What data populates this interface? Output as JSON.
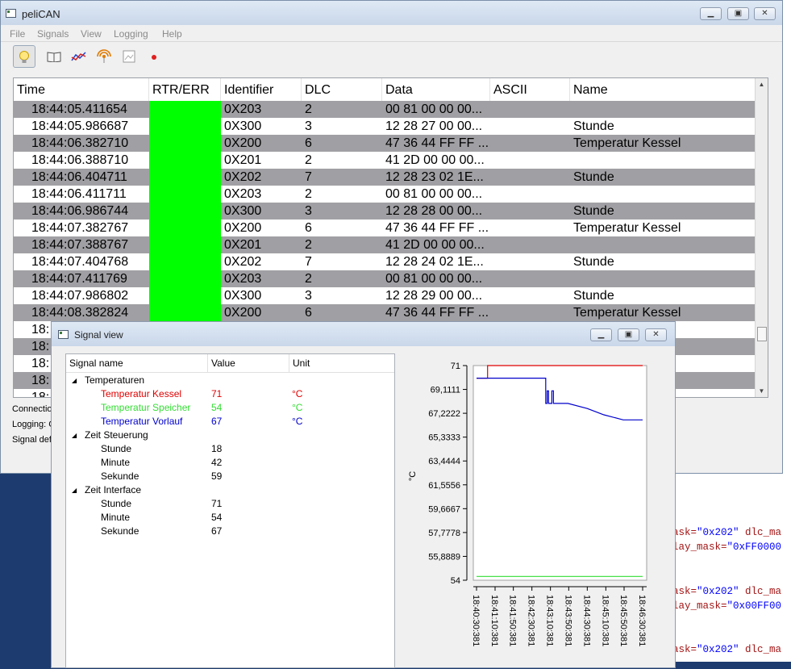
{
  "main_window": {
    "title": "peliCAN",
    "menu": [
      "File",
      "Signals",
      "View",
      "Logging",
      "Help"
    ],
    "toolbar_icons": [
      "lightbulb-icon",
      "book-icon",
      "graph-icon",
      "signal-icon",
      "image-icon",
      "record-icon"
    ]
  },
  "table": {
    "columns": [
      "Time",
      "RTR/ERR",
      "Identifier",
      "DLC",
      "Data",
      "ASCII",
      "Name"
    ],
    "rows": [
      {
        "time": "18:44:05.411654",
        "id": "0X203",
        "dlc": "2",
        "data": "00 81 00 00 00...",
        "name": ""
      },
      {
        "time": "18:44:05.986687",
        "id": "0X300",
        "dlc": "3",
        "data": "12 28 27 00 00...",
        "name": "Stunde"
      },
      {
        "time": "18:44:06.382710",
        "id": "0X200",
        "dlc": "6",
        "data": "47 36 44 FF FF ...",
        "name": "Temperatur Kessel"
      },
      {
        "time": "18:44:06.388710",
        "id": "0X201",
        "dlc": "2",
        "data": "41 2D 00 00 00...",
        "name": ""
      },
      {
        "time": "18:44:06.404711",
        "id": "0X202",
        "dlc": "7",
        "data": "12 28 23 02 1E...",
        "name": "Stunde"
      },
      {
        "time": "18:44:06.411711",
        "id": "0X203",
        "dlc": "2",
        "data": "00 81 00 00 00...",
        "name": ""
      },
      {
        "time": "18:44:06.986744",
        "id": "0X300",
        "dlc": "3",
        "data": "12 28 28 00 00...",
        "name": "Stunde"
      },
      {
        "time": "18:44:07.382767",
        "id": "0X200",
        "dlc": "6",
        "data": "47 36 44 FF FF ...",
        "name": "Temperatur Kessel"
      },
      {
        "time": "18:44:07.388767",
        "id": "0X201",
        "dlc": "2",
        "data": "41 2D 00 00 00...",
        "name": ""
      },
      {
        "time": "18:44:07.404768",
        "id": "0X202",
        "dlc": "7",
        "data": "12 28 24 02 1E...",
        "name": "Stunde"
      },
      {
        "time": "18:44:07.411769",
        "id": "0X203",
        "dlc": "2",
        "data": "00 81 00 00 00...",
        "name": ""
      },
      {
        "time": "18:44:07.986802",
        "id": "0X300",
        "dlc": "3",
        "data": "12 28 29 00 00...",
        "name": "Stunde"
      },
      {
        "time": "18:44:08.382824",
        "id": "0X200",
        "dlc": "6",
        "data": "47 36 44 FF FF ...",
        "name": "Temperatur Kessel"
      }
    ],
    "partial_row_prefix": "18:"
  },
  "status": {
    "connection": "Connectio",
    "logging": "Logging: C",
    "signal_def": "Signal def"
  },
  "signal_view": {
    "title": "Signal view",
    "columns": [
      "Signal name",
      "Value",
      "Unit"
    ],
    "groups": [
      {
        "name": "Temperaturen",
        "items": [
          {
            "name": "Temperatur Kessel",
            "value": "71",
            "unit": "°C",
            "color": "#e00000"
          },
          {
            "name": "Temperatur Speicher",
            "value": "54",
            "unit": "°C",
            "color": "#33dd33"
          },
          {
            "name": "Temperatur Vorlauf",
            "value": "67",
            "unit": "°C",
            "color": "#0000cc"
          }
        ]
      },
      {
        "name": "Zeit Steuerung",
        "items": [
          {
            "name": "Stunde",
            "value": "18",
            "unit": "",
            "color": "#000000"
          },
          {
            "name": "Minute",
            "value": "42",
            "unit": "",
            "color": "#000000"
          },
          {
            "name": "Sekunde",
            "value": "59",
            "unit": "",
            "color": "#000000"
          }
        ]
      },
      {
        "name": "Zeit Interface",
        "items": [
          {
            "name": "Stunde",
            "value": "71",
            "unit": "",
            "color": "#000000"
          },
          {
            "name": "Minute",
            "value": "54",
            "unit": "",
            "color": "#000000"
          },
          {
            "name": "Sekunde",
            "value": "67",
            "unit": "",
            "color": "#000000"
          }
        ]
      }
    ]
  },
  "chart_data": {
    "type": "line",
    "ylabel": "°C",
    "ylim": [
      54,
      71
    ],
    "yticks": [
      "71",
      "69,1111",
      "67,2222",
      "65,3333",
      "63,4444",
      "61,5556",
      "59,6667",
      "57,7778",
      "55,8889",
      "54"
    ],
    "xticks": [
      "18:40:30:381",
      "18:41:10:381",
      "18:41:50:381",
      "18:42:30:381",
      "18:43:10:381",
      "18:43:50:381",
      "18:44:30:381",
      "18:45:10:381",
      "18:45:50:381",
      "18:46:30:381"
    ],
    "x_minutes": [
      0,
      0.67,
      1.33,
      2,
      2.67,
      3.33,
      4,
      4.67,
      5.33,
      6
    ],
    "series": [
      {
        "color": "#e00000",
        "x": [
          0,
          0.4,
          0.4,
          6
        ],
        "y": [
          70,
          70,
          71,
          71
        ]
      },
      {
        "color": "#33dd33",
        "x": [
          0,
          6
        ],
        "y": [
          54.3,
          54.3
        ]
      },
      {
        "color": "#0000cc",
        "x": [
          0,
          2.5,
          2.5,
          2.55,
          2.55,
          2.6,
          2.6,
          2.72,
          2.72,
          2.78,
          2.78,
          3.3,
          4.0,
          4.6,
          5.3,
          6.0
        ],
        "y": [
          70,
          70,
          68.0,
          68.0,
          69.0,
          69.0,
          68.0,
          68.0,
          69.0,
          69.0,
          68.0,
          68.0,
          67.6,
          67.1,
          66.7,
          66.7
        ]
      }
    ]
  },
  "background_editor": {
    "lines": [
      {
        "a": "ask=",
        "b": "\"0x202\"",
        "c": " dlc_ma"
      },
      {
        "a": "lay_mask=",
        "b": "\"0xFF0000",
        "c": ""
      },
      {
        "a": "ask=",
        "b": "\"0x202\"",
        "c": " dlc_ma"
      },
      {
        "a": "lay_mask=",
        "b": "\"0x00FF00",
        "c": ""
      },
      {
        "a": "ask=",
        "b": "\"0x202\"",
        "c": " dlc_ma"
      }
    ]
  }
}
